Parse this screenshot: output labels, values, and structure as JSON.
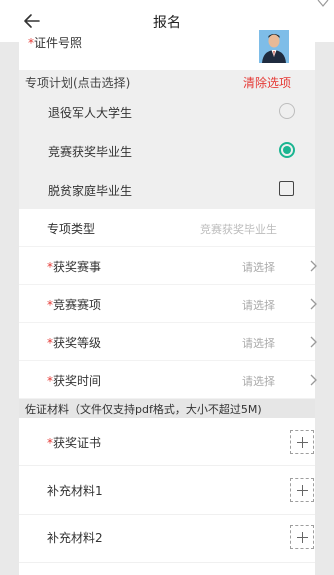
{
  "header": {
    "title": "报名",
    "back_icon": "arrow-left-icon"
  },
  "certificate": {
    "required_mark": "*",
    "label": "证件号照"
  },
  "special_plan": {
    "header_label": "专项计划(点击选择)",
    "clear_label": "清除选项",
    "items": [
      {
        "label": "退役军人大学生",
        "control": "radio",
        "checked": false
      },
      {
        "label": "竞赛获奖毕业生",
        "control": "radio",
        "checked": true
      },
      {
        "label": "脱贫家庭毕业生",
        "control": "checkbox",
        "checked": false
      }
    ]
  },
  "form": {
    "special_type": {
      "label": "专项类型",
      "value": "竞赛获奖毕业生"
    },
    "rows": [
      {
        "required_mark": "*",
        "label": "获奖赛事",
        "placeholder": "请选择"
      },
      {
        "required_mark": "*",
        "label": "竞赛赛项",
        "placeholder": "请选择"
      },
      {
        "required_mark": "*",
        "label": "获奖等级",
        "placeholder": "请选择"
      },
      {
        "required_mark": "*",
        "label": "获奖时间",
        "placeholder": "请选择"
      }
    ]
  },
  "materials": {
    "header_label": "佐证材料（文件仅支持pdf格式，大小不超过5M)",
    "items": [
      {
        "required_mark": "*",
        "label": "获奖证书"
      },
      {
        "required_mark": "",
        "label": "补充材料1"
      },
      {
        "required_mark": "",
        "label": "补充材料2"
      }
    ]
  },
  "colors": {
    "accent_green": "#1bb591",
    "required_red": "#e53935",
    "placeholder_gray": "#aaaaaa"
  }
}
